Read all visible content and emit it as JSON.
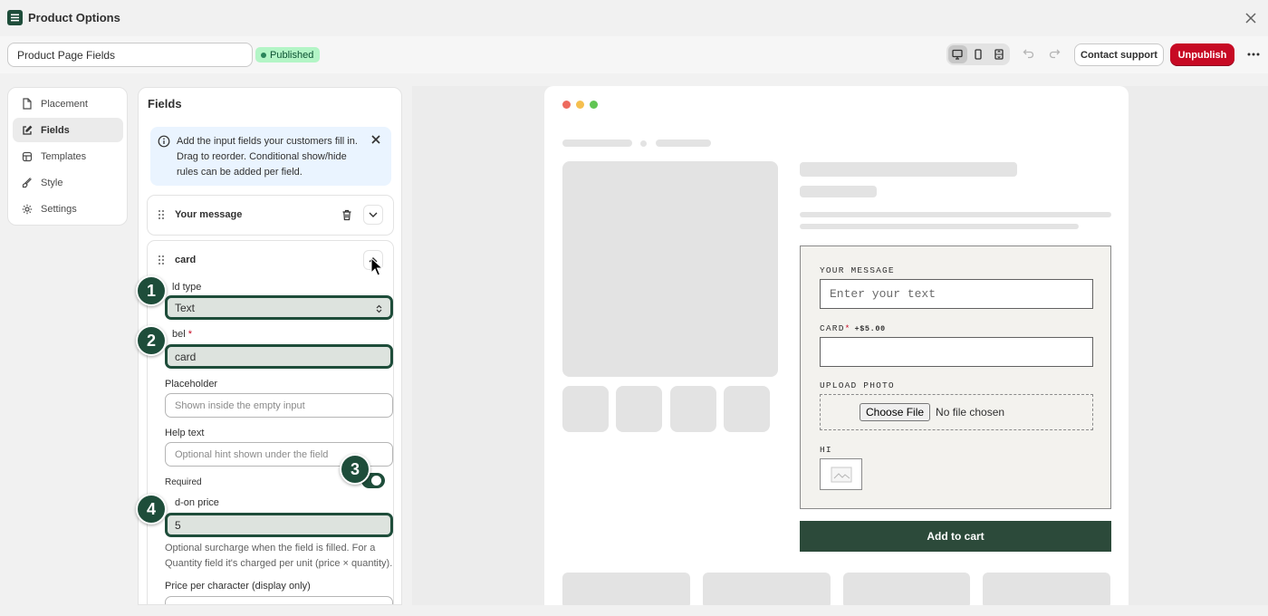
{
  "app": {
    "title": "Product Options"
  },
  "toolbar": {
    "name_value": "Product Page Fields",
    "status": "Published",
    "contact_label": "Contact support",
    "unpublish_label": "Unpublish"
  },
  "nav": {
    "items": [
      {
        "label": "Placement",
        "icon": "file-icon"
      },
      {
        "label": "Fields",
        "icon": "edit-icon",
        "active": true
      },
      {
        "label": "Templates",
        "icon": "template-icon"
      },
      {
        "label": "Style",
        "icon": "brush-icon"
      },
      {
        "label": "Settings",
        "icon": "gear-icon"
      }
    ]
  },
  "fields_panel": {
    "heading": "Fields",
    "banner_text": "Add the input fields your customers fill in. Drag to reorder. Conditional show/hide rules can be added per field.",
    "field_1_title": "Your message",
    "field_2_title": "card",
    "field_type_label": "ld type",
    "field_type_value": "Text",
    "label_label": "bel",
    "label_value": "card",
    "placeholder_label": "Placeholder",
    "placeholder_placeholder": "Shown inside the empty input",
    "help_text_label": "Help text",
    "help_text_placeholder": "Optional hint shown under the field",
    "required_label": "Required",
    "required_on": true,
    "addon_label": "d-on price",
    "addon_value": "5",
    "addon_help": "Optional surcharge when the field is filled. For a Quantity field it's charged per unit (price × quantity).",
    "price_per_char_label": "Price per character (display only)"
  },
  "steps": [
    "1",
    "2",
    "3",
    "4"
  ],
  "preview": {
    "your_message_label": "YOUR MESSAGE",
    "your_message_placeholder": "Enter your text",
    "card_label": "CARD",
    "card_required_mark": "*",
    "card_price": "+$5.00",
    "upload_label": "UPLOAD PHOTO",
    "choose_file": "Choose File",
    "no_file": "No file chosen",
    "hi_label": "HI",
    "add_to_cart": "Add to cart"
  },
  "colors": {
    "brand_dark_green": "#1e4d3a",
    "unpublish_red": "#c70a24",
    "published_badge": "#b3f5c6",
    "info_banner": "#eaf4ff"
  }
}
